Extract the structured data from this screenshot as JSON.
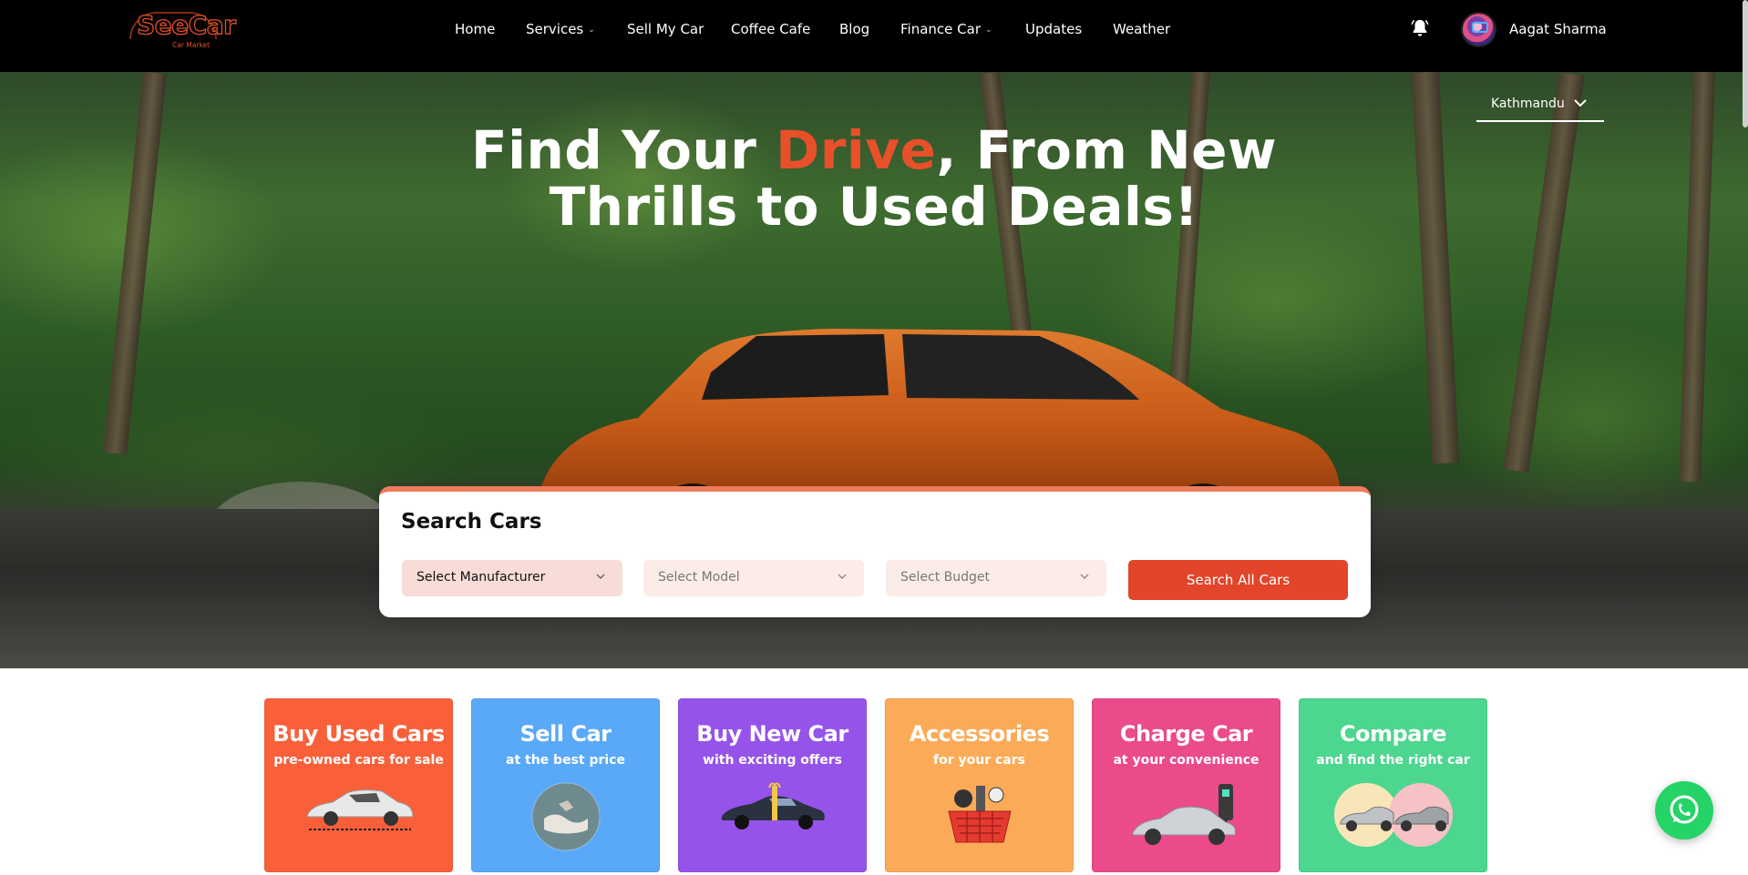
{
  "nav": {
    "logo_text": "SeeCar",
    "logo_subtext": "Car Market",
    "links": [
      {
        "label": "Home",
        "has_caret": false
      },
      {
        "label": "Services",
        "has_caret": true
      },
      {
        "label": "Sell My Car",
        "has_caret": false
      },
      {
        "label": "Coffee Cafe",
        "has_caret": false
      },
      {
        "label": "Blog",
        "has_caret": false
      },
      {
        "label": "Finance Car",
        "has_caret": true
      },
      {
        "label": "Updates",
        "has_caret": false
      },
      {
        "label": "Weather",
        "has_caret": false
      }
    ],
    "notification_icon": "bell-icon",
    "user_name": "Aagat Sharma"
  },
  "hero": {
    "title_part1": "Find Your ",
    "title_accent": "Drive",
    "title_part2": ", From New",
    "title_line2": "Thrills to Used Deals!",
    "location": "Kathmandu"
  },
  "search": {
    "title": "Search Cars",
    "manufacturer_placeholder": "Select Manufacturer",
    "model_placeholder": "Select Model",
    "budget_placeholder": "Select Budget",
    "button_label": "Search All Cars"
  },
  "tiles": [
    {
      "title": "Buy Used Cars",
      "subtitle": "pre-owned cars for sale",
      "color": "#f9603a",
      "icon": "sedan-car-icon"
    },
    {
      "title": "Sell Car",
      "subtitle": "at the best price",
      "color": "#5aa9f8",
      "icon": "handshake-icon"
    },
    {
      "title": "Buy New Car",
      "subtitle": "with exciting offers",
      "color": "#9653ea",
      "icon": "gift-car-icon"
    },
    {
      "title": "Accessories",
      "subtitle": "for your cars",
      "color": "#fbab57",
      "icon": "accessories-basket-icon"
    },
    {
      "title": "Charge Car",
      "subtitle": "at your convenience",
      "color": "#eb4a8b",
      "icon": "ev-charging-icon"
    },
    {
      "title": "Compare",
      "subtitle": "and find the right car",
      "color": "#4dd68f",
      "icon": "compare-cars-icon"
    }
  ],
  "colors": {
    "brand_accent": "#e8502a",
    "nav_bg": "#000000",
    "search_button": "#e2452a"
  },
  "floating": {
    "whatsapp_icon": "whatsapp-icon"
  }
}
